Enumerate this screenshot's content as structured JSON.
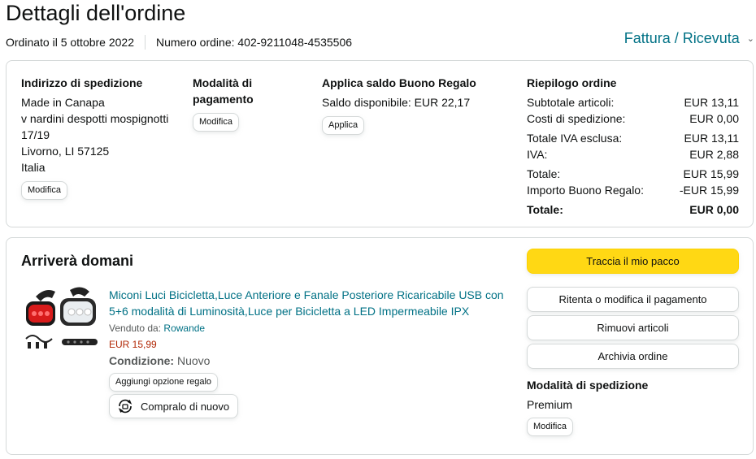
{
  "header": {
    "title": "Dettagli dell'ordine",
    "ordered_on": "Ordinato il 5 ottobre 2022",
    "order_number": "Numero ordine: 402-9211048-4535506",
    "invoice_link": "Fattura / Ricevuta"
  },
  "shipping_address": {
    "heading": "Indirizzo di spedizione",
    "lines": [
      "Made in Canapa",
      "v nardini despotti mospignotti",
      "17/19",
      "Livorno, LI 57125",
      "Italia"
    ],
    "edit_label": "Modifica"
  },
  "payment_method": {
    "heading_line1": "Modalità di",
    "heading_line2": "pagamento",
    "edit_label": "Modifica"
  },
  "gift_card": {
    "heading": "Applica saldo Buono Regalo",
    "balance": "Saldo disponibile: EUR 22,17",
    "apply_label": "Applica"
  },
  "order_summary": {
    "heading": "Riepilogo ordine",
    "rows": [
      {
        "label": "Subtotale articoli:",
        "value": "EUR 13,11"
      },
      {
        "label": "Costi di spedizione:",
        "value": "EUR 0,00"
      },
      {
        "label": "Totale IVA esclusa:",
        "value": "EUR 13,11"
      },
      {
        "label": "IVA:",
        "value": "EUR 2,88"
      },
      {
        "label": "Totale:",
        "value": "EUR 15,99"
      },
      {
        "label": "Importo Buono Regalo:",
        "value": "-EUR 15,99"
      },
      {
        "label": "Totale:",
        "value": "EUR 0,00"
      }
    ]
  },
  "shipment": {
    "arrival": "Arriverà domani",
    "product_title": "Miconi Luci Bicicletta,Luce Anteriore e Fanale Posteriore Ricaricabile USB con 5+6 modalità di Luminosità,Luce per Bicicletta a LED Impermeabile IPX",
    "sold_by_label": "Venduto da:",
    "seller": "Rowande",
    "price": "EUR 15,99",
    "condition_label": "Condizione:",
    "condition_value": "Nuovo",
    "gift_option_label": "Aggiungi opzione regalo",
    "buy_again_label": "Compralo di nuovo",
    "actions": {
      "track": "Traccia il mio pacco",
      "retry_payment": "Ritenta o modifica il pagamento",
      "remove_items": "Rimuovi articoli",
      "archive": "Archivia ordine"
    },
    "shipping_method_heading": "Modalità di spedizione",
    "shipping_method_value": "Premium",
    "shipping_method_edit": "Modifica"
  },
  "colors": {
    "link": "#007185",
    "price": "#b12704",
    "primary_button": "#ffd814",
    "border": "#d5d9d9"
  }
}
